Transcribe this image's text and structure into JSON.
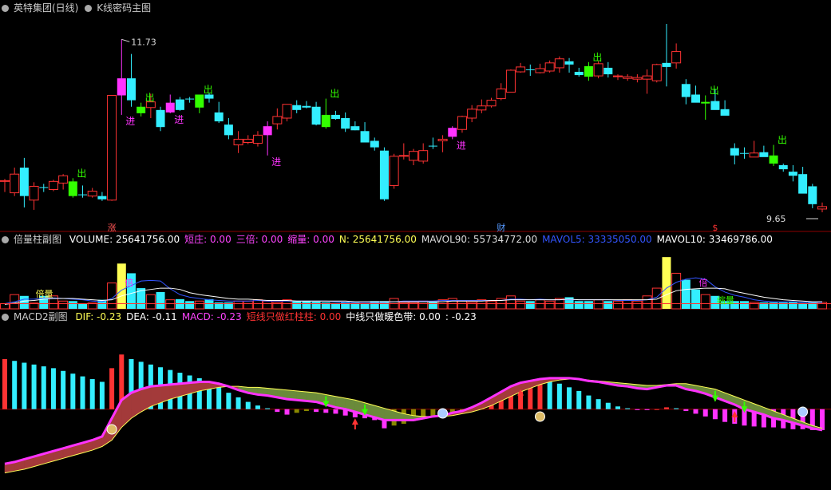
{
  "header": {
    "stock": "英特集团(日线)",
    "indicator": "K线密码主图"
  },
  "vol_header": {
    "name": "倍量柱副图",
    "items": [
      {
        "text": "VOLUME: 25641756.00",
        "color": "#ffffff"
      },
      {
        "text": "短庄: 0.00",
        "color": "#ff44ff"
      },
      {
        "text": "三倍: 0.00",
        "color": "#ff44ff"
      },
      {
        "text": "缩量: 0.00",
        "color": "#ff44ff"
      },
      {
        "text": "N: 25641756.00",
        "color": "#ffff55"
      },
      {
        "text": "MAVOL90: 55734772.00",
        "color": "#dddddd"
      },
      {
        "text": "MAVOL5: 33335050.00",
        "color": "#3355ff"
      },
      {
        "text": "MAVOL10: 33469786.00",
        "color": "#ffffff"
      }
    ]
  },
  "macd_header": {
    "name": "MACD2副图",
    "items": [
      {
        "text": "DIF: -0.23",
        "color": "#ffff55"
      },
      {
        "text": "DEA: -0.11",
        "color": "#ffffff"
      },
      {
        "text": "MACD: -0.23",
        "color": "#ff44ff"
      },
      {
        "text": "短线只做红柱柱: 0.00",
        "color": "#ff3333"
      },
      {
        "text": "中线只做暖色带: 0.00",
        "color": "#ffffff"
      },
      {
        "text": ": -0.23",
        "color": "#ffffff"
      }
    ]
  },
  "colors": {
    "up": "#ff3333",
    "down": "#33eeff",
    "magenta": "#ff33ff",
    "green": "#33ff00",
    "yellow": "#ffff55"
  },
  "chart_data": [
    {
      "type": "candlestick",
      "title": "K线密码主图",
      "annotations": {
        "max_label": "11.73",
        "min_label": "9.65",
        "buy": "进",
        "sell": "出",
        "markers": [
          "涨",
          "财",
          "$"
        ]
      },
      "ohlc": [
        [
          9.98,
          10.01,
          9.85,
          9.99
        ],
        [
          9.84,
          10.15,
          9.8,
          10.07
        ],
        [
          10.15,
          10.27,
          9.66,
          9.8
        ],
        [
          9.75,
          9.97,
          9.63,
          9.92
        ],
        [
          9.91,
          9.95,
          9.85,
          9.9
        ],
        [
          9.88,
          10.0,
          9.86,
          9.98
        ],
        [
          9.96,
          10.07,
          9.88,
          10.05
        ],
        [
          9.98,
          10.02,
          9.78,
          9.8
        ],
        [
          9.82,
          9.93,
          9.78,
          9.82
        ],
        [
          9.8,
          9.9,
          9.78,
          9.86
        ],
        [
          9.8,
          9.85,
          9.74,
          9.76
        ],
        [
          9.75,
          11.04,
          9.74,
          11.04
        ],
        [
          11.04,
          11.73,
          10.8,
          11.25
        ],
        [
          11.25,
          11.55,
          10.9,
          10.98
        ],
        [
          10.9,
          10.95,
          10.78,
          10.82
        ],
        [
          10.89,
          11.06,
          10.76,
          10.96
        ],
        [
          10.86,
          10.9,
          10.6,
          10.65
        ],
        [
          10.83,
          11.05,
          10.82,
          10.95
        ],
        [
          10.99,
          11.02,
          10.85,
          10.86
        ],
        [
          11.0,
          11.02,
          10.95,
          11.0
        ],
        [
          10.89,
          11.05,
          10.82,
          11.05
        ],
        [
          11.05,
          11.07,
          10.95,
          11.0
        ],
        [
          10.83,
          10.96,
          10.7,
          10.72
        ],
        [
          10.68,
          10.76,
          10.5,
          10.55
        ],
        [
          10.43,
          10.6,
          10.33,
          10.5
        ],
        [
          10.46,
          10.55,
          10.44,
          10.5
        ],
        [
          10.45,
          10.6,
          10.41,
          10.55
        ],
        [
          10.55,
          10.72,
          10.3,
          10.66
        ],
        [
          10.69,
          10.88,
          10.62,
          10.78
        ],
        [
          10.76,
          10.93,
          10.72,
          10.93
        ],
        [
          10.92,
          10.98,
          10.82,
          10.86
        ],
        [
          10.91,
          10.97,
          10.88,
          10.89
        ],
        [
          10.9,
          10.96,
          10.67,
          10.68
        ],
        [
          10.8,
          11.0,
          10.63,
          10.65
        ],
        [
          10.8,
          10.85,
          10.74,
          10.75
        ],
        [
          10.76,
          10.83,
          10.59,
          10.63
        ],
        [
          10.66,
          10.72,
          10.61,
          10.61
        ],
        [
          10.6,
          10.71,
          10.52,
          10.46
        ],
        [
          10.48,
          10.52,
          10.36,
          10.4
        ],
        [
          10.36,
          10.4,
          9.74,
          9.76
        ],
        [
          9.93,
          10.32,
          9.89,
          10.29
        ],
        [
          10.29,
          10.45,
          10.25,
          10.3
        ],
        [
          10.24,
          10.38,
          10.18,
          10.35
        ],
        [
          10.23,
          10.45,
          10.2,
          10.36
        ],
        [
          10.42,
          10.52,
          10.38,
          10.42
        ],
        [
          10.48,
          10.55,
          10.34,
          10.5
        ],
        [
          10.53,
          10.66,
          10.5,
          10.64
        ],
        [
          10.62,
          10.79,
          10.58,
          10.78
        ],
        [
          10.76,
          10.92,
          10.71,
          10.87
        ],
        [
          10.86,
          10.99,
          10.82,
          10.91
        ],
        [
          10.91,
          11.01,
          10.89,
          10.98
        ],
        [
          11.0,
          11.19,
          10.98,
          11.12
        ],
        [
          11.08,
          11.36,
          11.08,
          11.35
        ],
        [
          11.33,
          11.44,
          11.32,
          11.39
        ],
        [
          11.36,
          11.42,
          11.28,
          11.36
        ],
        [
          11.32,
          11.43,
          11.31,
          11.37
        ],
        [
          11.34,
          11.47,
          11.32,
          11.44
        ],
        [
          11.38,
          11.52,
          11.32,
          11.49
        ],
        [
          11.46,
          11.5,
          11.32,
          11.42
        ],
        [
          11.33,
          11.38,
          11.27,
          11.29
        ],
        [
          11.4,
          11.45,
          11.22,
          11.27
        ],
        [
          11.28,
          11.46,
          11.25,
          11.43
        ],
        [
          11.38,
          11.45,
          11.26,
          11.3
        ],
        [
          11.27,
          11.3,
          11.23,
          11.28
        ],
        [
          11.25,
          11.3,
          11.22,
          11.27
        ],
        [
          11.24,
          11.3,
          11.2,
          11.26
        ],
        [
          11.24,
          11.36,
          11.06,
          11.28
        ],
        [
          11.22,
          11.43,
          11.2,
          11.42
        ],
        [
          11.44,
          11.92,
          11.15,
          11.39
        ],
        [
          11.44,
          11.68,
          11.37,
          11.58
        ],
        [
          11.18,
          11.24,
          10.93,
          11.02
        ],
        [
          11.05,
          11.16,
          10.96,
          10.95
        ],
        [
          10.94,
          11.04,
          10.74,
          10.96
        ],
        [
          10.97,
          11.12,
          10.96,
          10.86
        ],
        [
          10.87,
          10.98,
          10.82,
          10.79
        ],
        [
          10.39,
          10.45,
          10.19,
          10.3
        ],
        [
          10.33,
          10.4,
          10.26,
          10.33
        ],
        [
          10.28,
          10.48,
          10.28,
          10.33
        ],
        [
          10.34,
          10.42,
          10.3,
          10.28
        ],
        [
          10.3,
          10.43,
          10.17,
          10.2
        ],
        [
          10.18,
          10.2,
          10.1,
          10.13
        ],
        [
          10.1,
          10.18,
          9.98,
          10.05
        ],
        [
          10.07,
          10.16,
          9.91,
          9.83
        ],
        [
          9.92,
          9.95,
          9.65,
          9.7
        ],
        [
          9.64,
          9.72,
          9.6,
          9.67
        ]
      ]
    },
    {
      "type": "bar",
      "title": "倍量柱副图",
      "labels": [
        "倍量",
        "倍",
        "倍",
        "缩量"
      ],
      "values": [
        8,
        22,
        20,
        9,
        20,
        20,
        12,
        12,
        8,
        9,
        14,
        40,
        70,
        55,
        32,
        22,
        26,
        14,
        15,
        12,
        12,
        15,
        10,
        10,
        12,
        12,
        14,
        12,
        10,
        14,
        12,
        12,
        11,
        10,
        9,
        10,
        9,
        8,
        12,
        12,
        16,
        10,
        10,
        12,
        11,
        14,
        16,
        12,
        10,
        14,
        12,
        16,
        20,
        12,
        12,
        14,
        12,
        16,
        18,
        12,
        12,
        14,
        12,
        12,
        14,
        12,
        20,
        32,
        80,
        55,
        45,
        30,
        22,
        20,
        12,
        12,
        12,
        10,
        10,
        10,
        10,
        11,
        9,
        10,
        10
      ],
      "ma5": [
        8,
        11,
        15,
        15,
        17,
        17,
        16,
        15,
        14,
        12,
        11,
        16,
        29,
        36,
        43,
        44,
        43,
        31,
        22,
        18,
        16,
        14,
        13,
        12,
        12,
        12,
        13,
        12,
        12,
        12,
        12,
        12,
        12,
        12,
        11,
        10,
        10,
        10,
        10,
        10,
        11,
        12,
        12,
        12,
        12,
        13,
        13,
        13,
        13,
        13,
        13,
        13,
        15,
        15,
        14,
        15,
        14,
        14,
        14,
        14,
        14,
        14,
        14,
        13,
        13,
        13,
        14,
        18,
        32,
        41,
        46,
        48,
        46,
        34,
        26,
        21,
        18,
        14,
        12,
        11,
        11,
        11,
        10,
        10,
        10
      ],
      "ma10": [
        7,
        9,
        12,
        13,
        15,
        16,
        16,
        16,
        15,
        14,
        13,
        14,
        20,
        24,
        28,
        30,
        32,
        32,
        30,
        25,
        22,
        20,
        18,
        16,
        15,
        15,
        14,
        13,
        13,
        13,
        12,
        12,
        12,
        12,
        12,
        12,
        11,
        11,
        11,
        11,
        11,
        11,
        11,
        11,
        11,
        11,
        12,
        12,
        12,
        12,
        13,
        13,
        14,
        14,
        14,
        14,
        14,
        14,
        15,
        14,
        14,
        14,
        14,
        14,
        14,
        14,
        14,
        15,
        22,
        28,
        30,
        31,
        32,
        32,
        31,
        27,
        24,
        21,
        18,
        16,
        14,
        13,
        12,
        11,
        11
      ],
      "ylim": [
        0,
        95
      ]
    },
    {
      "type": "bar+line",
      "title": "MACD2副图",
      "macd": [
        0.55,
        0.53,
        0.51,
        0.49,
        0.47,
        0.45,
        0.42,
        0.39,
        0.36,
        0.33,
        0.3,
        0.45,
        0.6,
        0.55,
        0.52,
        0.49,
        0.46,
        0.43,
        0.4,
        0.37,
        0.34,
        0.3,
        0.24,
        0.18,
        0.13,
        0.08,
        0.04,
        0.01,
        -0.03,
        -0.06,
        -0.04,
        -0.02,
        -0.03,
        -0.04,
        -0.05,
        -0.07,
        -0.09,
        -0.1,
        -0.12,
        -0.21,
        -0.18,
        -0.16,
        -0.13,
        -0.1,
        -0.08,
        -0.06,
        -0.04,
        -0.02,
        0.02,
        0.07,
        0.12,
        0.18,
        0.24,
        0.29,
        0.31,
        0.32,
        0.31,
        0.28,
        0.24,
        0.2,
        0.15,
        0.11,
        0.07,
        0.03,
        0.01,
        -0.01,
        -0.01,
        0.0,
        0.02,
        0.01,
        -0.02,
        -0.05,
        -0.08,
        -0.11,
        -0.14,
        -0.16,
        -0.18,
        -0.19,
        -0.2,
        -0.2,
        -0.21,
        -0.22,
        -0.22,
        -0.23,
        -0.23
      ],
      "dif": [
        -0.6,
        -0.58,
        -0.55,
        -0.52,
        -0.49,
        -0.46,
        -0.43,
        -0.4,
        -0.37,
        -0.34,
        -0.3,
        -0.1,
        0.1,
        0.18,
        0.22,
        0.25,
        0.26,
        0.27,
        0.28,
        0.29,
        0.3,
        0.3,
        0.28,
        0.25,
        0.21,
        0.18,
        0.16,
        0.15,
        0.13,
        0.11,
        0.1,
        0.09,
        0.08,
        0.05,
        0.02,
        0.0,
        -0.03,
        -0.06,
        -0.09,
        -0.12,
        -0.12,
        -0.12,
        -0.12,
        -0.1,
        -0.08,
        -0.07,
        -0.04,
        -0.02,
        0.02,
        0.07,
        0.13,
        0.19,
        0.25,
        0.29,
        0.31,
        0.33,
        0.34,
        0.34,
        0.34,
        0.33,
        0.31,
        0.3,
        0.28,
        0.26,
        0.25,
        0.23,
        0.22,
        0.24,
        0.26,
        0.26,
        0.22,
        0.2,
        0.17,
        0.13,
        0.09,
        0.05,
        0.0,
        -0.03,
        -0.06,
        -0.1,
        -0.12,
        -0.15,
        -0.18,
        -0.21,
        -0.23
      ],
      "dea": [
        -0.7,
        -0.68,
        -0.66,
        -0.63,
        -0.6,
        -0.57,
        -0.54,
        -0.51,
        -0.48,
        -0.45,
        -0.41,
        -0.34,
        -0.2,
        -0.1,
        -0.03,
        0.03,
        0.07,
        0.11,
        0.14,
        0.17,
        0.2,
        0.22,
        0.24,
        0.25,
        0.25,
        0.24,
        0.24,
        0.23,
        0.22,
        0.21,
        0.2,
        0.19,
        0.18,
        0.16,
        0.14,
        0.12,
        0.1,
        0.07,
        0.04,
        0.01,
        -0.02,
        -0.05,
        -0.07,
        -0.08,
        -0.08,
        -0.08,
        -0.07,
        -0.05,
        -0.03,
        0.0,
        0.04,
        0.09,
        0.14,
        0.19,
        0.23,
        0.27,
        0.3,
        0.32,
        0.33,
        0.33,
        0.32,
        0.31,
        0.3,
        0.29,
        0.28,
        0.27,
        0.26,
        0.26,
        0.27,
        0.28,
        0.28,
        0.26,
        0.24,
        0.22,
        0.18,
        0.14,
        0.1,
        0.06,
        0.02,
        -0.02,
        -0.06,
        -0.1,
        -0.14,
        -0.18,
        -0.21
      ],
      "ylim": [
        -0.8,
        0.9
      ]
    }
  ]
}
